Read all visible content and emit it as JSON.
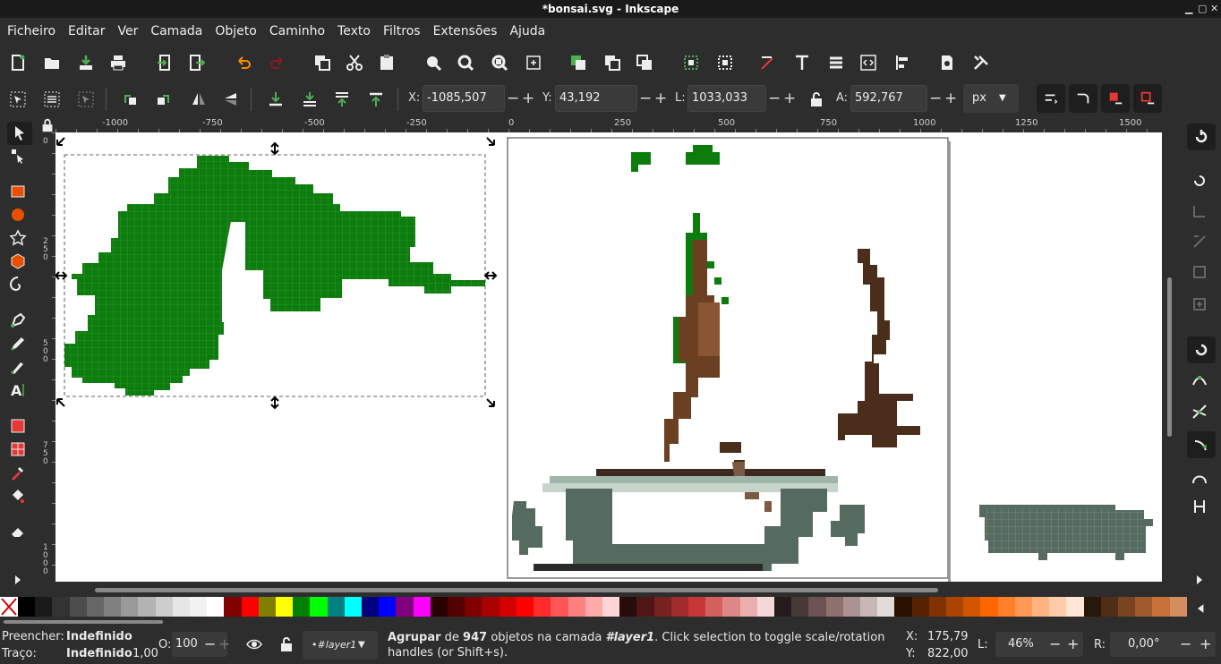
{
  "window": {
    "title": "*bonsai.svg - Inkscape"
  },
  "menu": [
    "Ficheiro",
    "Editar",
    "Ver",
    "Camada",
    "Objeto",
    "Caminho",
    "Texto",
    "Filtros",
    "Extensões",
    "Ajuda"
  ],
  "toolctrl": {
    "x_label": "X:",
    "x_value": "-1085,507",
    "y_label": "Y:",
    "y_value": "43,192",
    "w_label": "L:",
    "w_value": "1033,033",
    "h_label": "A:",
    "h_value": "592,767",
    "unit": "px"
  },
  "ruler": {
    "h_ticks": [
      "-1000",
      "-750",
      "-500",
      "-250",
      "0",
      "250",
      "500",
      "750",
      "1000",
      "1250",
      "1500"
    ],
    "v_ticks": [
      "0",
      "2\n5\n0",
      "5\n0\n0",
      "7\n5\n0",
      "1\n0\n0\n0"
    ]
  },
  "colors": {
    "green": "#0c7d0c",
    "brown": "#6b3f22",
    "pot": "#566b60"
  },
  "palette": [
    "#000000",
    "#1a1a1a",
    "#333333",
    "#4d4d4d",
    "#666666",
    "#808080",
    "#999999",
    "#b3b3b3",
    "#cccccc",
    "#e6e6e6",
    "#f2f2f2",
    "#ffffff",
    "#800000",
    "#ff0000",
    "#808000",
    "#ffff00",
    "#008000",
    "#00ff00",
    "#008080",
    "#00ffff",
    "#000080",
    "#0000ff",
    "#800080",
    "#ff00ff",
    "#2b0000",
    "#550000",
    "#800000",
    "#aa0000",
    "#d40000",
    "#ff0000",
    "#ff2a2a",
    "#ff5555",
    "#ff8080",
    "#ffaaaa",
    "#ffd5d5",
    "#280b0b",
    "#501616",
    "#782121",
    "#a02c2c",
    "#c83737",
    "#d35f5f",
    "#de8787",
    "#e9afaf",
    "#f4d7d7",
    "#241c1c",
    "#483737",
    "#6c5353",
    "#916f6f",
    "#ac9393",
    "#c8b7b7",
    "#e3dbdb",
    "#2b1100",
    "#552200",
    "#803300",
    "#aa4400",
    "#d45500",
    "#ff6600",
    "#ff7f2a",
    "#ff9955",
    "#ffb380",
    "#ffccaa",
    "#ffe6d5",
    "#28170b",
    "#502d16",
    "#784421",
    "#a05a2c",
    "#c87137",
    "#d38d5f"
  ],
  "status": {
    "fill_label": "Preencher:",
    "fill_value": "Indefinido",
    "stroke_label": "Traço:",
    "stroke_value": "Indefinido",
    "stroke_width": "1,00",
    "opacity_label": "O:",
    "opacity_value": "100",
    "layer": "•#layer1",
    "message_bold1": "Agrupar",
    "message_text1": " de ",
    "message_bold2": "947",
    "message_text2": " objetos na camada ",
    "message_bold3": "#layer1",
    "message_text3": ". Click selection to toggle scale/rotation handles (or Shift+s).",
    "cx_label": "X:",
    "cx_value": "175,79",
    "cy_label": "Y:",
    "cy_value": "822,00",
    "zoom_label": "L:",
    "zoom_value": "46%",
    "rot_label": "R:",
    "rot_value": "0,00°"
  }
}
